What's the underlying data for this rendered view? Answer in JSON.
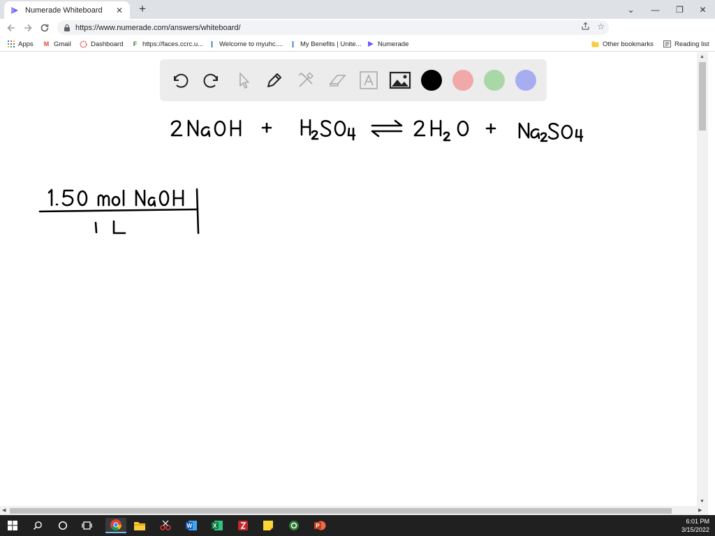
{
  "browser": {
    "tab_title": "Numerade Whiteboard",
    "tab_close": "✕",
    "new_tab": "+",
    "url": "https://www.numerade.com/answers/whiteboard/",
    "window": {
      "minimize": "⌄",
      "min": "—",
      "max": "❐",
      "close": "✕"
    }
  },
  "bookmarks": [
    {
      "label": "Apps"
    },
    {
      "label": "Gmail"
    },
    {
      "label": "Dashboard"
    },
    {
      "label": "https://faces.ccrc.u..."
    },
    {
      "label": "Welcome to myuhc...."
    },
    {
      "label": "My Benefits | Unite..."
    },
    {
      "label": "Numerade"
    }
  ],
  "bookmarks_right": {
    "other": "Other bookmarks",
    "reading": "Reading list"
  },
  "whiteboard": {
    "colors": {
      "black": "#000000",
      "red": "#f0a8a8",
      "green": "#a8d8a8",
      "blue": "#a8acf0"
    },
    "equation_text": "2 NaOH + H₂SO₄ ⇌ 2 H₂O + Na₂SO₄",
    "fraction_text": "1.50 mol NaOH / 1 L"
  },
  "taskbar": {
    "time": "6:01 PM",
    "date": "3/15/2022"
  }
}
